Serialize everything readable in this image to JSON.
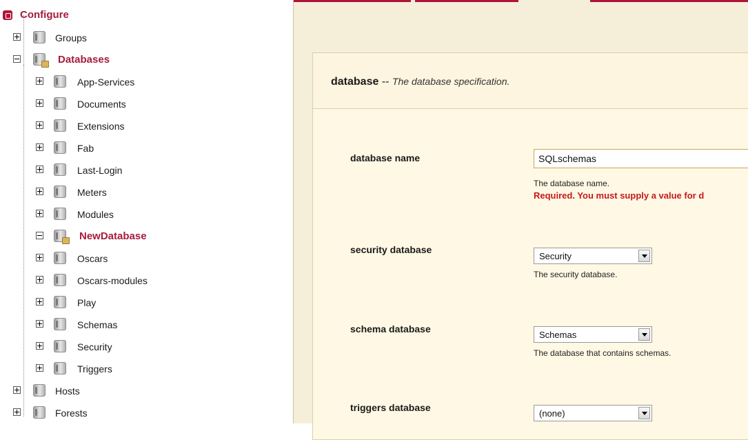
{
  "tree": {
    "root_label": "Configure",
    "groups_label": "Groups",
    "databases_label": "Databases",
    "databases": [
      "App-Services",
      "Documents",
      "Extensions",
      "Fab",
      "Last-Login",
      "Meters",
      "Modules",
      "NewDatabase",
      "Oscars",
      "Oscars-modules",
      "Play",
      "Schemas",
      "Security",
      "Triggers"
    ],
    "hosts_label": "Hosts",
    "forests_label": "Forests"
  },
  "form": {
    "title_bold": "database",
    "title_sep": "--",
    "title_desc": "The database specification.",
    "fields": {
      "database_name": {
        "label": "database name",
        "value": "SQLschemas",
        "help": "The database name.",
        "error": "Required. You must supply a value for d"
      },
      "security_database": {
        "label": "security database",
        "value": "Security",
        "help": "The security database."
      },
      "schema_database": {
        "label": "schema database",
        "value": "Schemas",
        "help": "The database that contains schemas."
      },
      "triggers_database": {
        "label": "triggers database",
        "value": "(none)"
      }
    }
  },
  "colors": {
    "accent": "#a61c3c",
    "panel_bg": "#f5efd9",
    "error": "#c41a1a"
  }
}
